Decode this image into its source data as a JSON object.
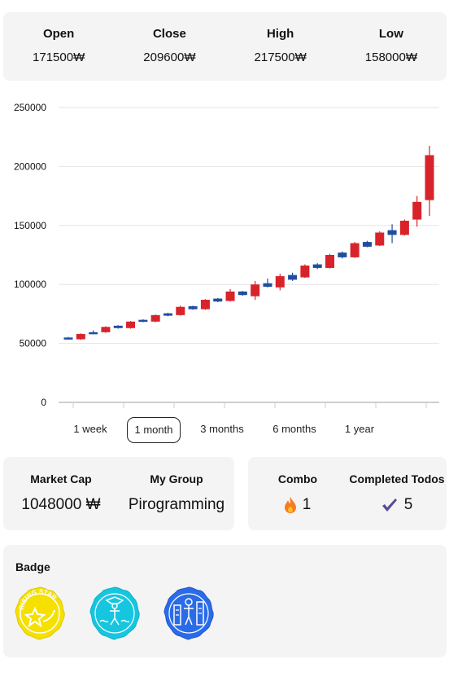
{
  "summary": {
    "open": {
      "label": "Open",
      "value": "171500₩"
    },
    "close": {
      "label": "Close",
      "value": "209600₩"
    },
    "high": {
      "label": "High",
      "value": "217500₩"
    },
    "low": {
      "label": "Low",
      "value": "158000₩"
    }
  },
  "chart_data": {
    "type": "candlestick",
    "ylim": [
      0,
      250000
    ],
    "yticks": [
      "250000",
      "200000",
      "150000",
      "100000",
      "50000",
      "0"
    ],
    "colors": {
      "up": "#d8232a",
      "down": "#1e4ea0",
      "grid": "#e6e6e6"
    },
    "candles": [
      {
        "open": 55000,
        "close": 54000,
        "high": 55500,
        "low": 53500
      },
      {
        "open": 53500,
        "close": 58000,
        "high": 58500,
        "low": 53000
      },
      {
        "open": 59500,
        "close": 58500,
        "high": 61000,
        "low": 58000
      },
      {
        "open": 59500,
        "close": 64000,
        "high": 64500,
        "low": 59000
      },
      {
        "open": 65000,
        "close": 63000,
        "high": 65500,
        "low": 62500
      },
      {
        "open": 63000,
        "close": 68500,
        "high": 69000,
        "low": 62500
      },
      {
        "open": 70000,
        "close": 68500,
        "high": 70500,
        "low": 68000
      },
      {
        "open": 68500,
        "close": 74000,
        "high": 74500,
        "low": 68000
      },
      {
        "open": 75500,
        "close": 73500,
        "high": 76000,
        "low": 73000
      },
      {
        "open": 74000,
        "close": 81000,
        "high": 82000,
        "low": 73500
      },
      {
        "open": 81500,
        "close": 79000,
        "high": 82000,
        "low": 78500
      },
      {
        "open": 79000,
        "close": 87000,
        "high": 87500,
        "low": 78500
      },
      {
        "open": 88000,
        "close": 85500,
        "high": 88500,
        "low": 85000
      },
      {
        "open": 86000,
        "close": 94000,
        "high": 96000,
        "low": 85500
      },
      {
        "open": 94000,
        "close": 91000,
        "high": 94500,
        "low": 90500
      },
      {
        "open": 90000,
        "close": 100000,
        "high": 103000,
        "low": 87000
      },
      {
        "open": 101000,
        "close": 98000,
        "high": 105000,
        "low": 97500
      },
      {
        "open": 97500,
        "close": 107000,
        "high": 109000,
        "low": 95000
      },
      {
        "open": 108000,
        "close": 104000,
        "high": 110000,
        "low": 103000
      },
      {
        "open": 106000,
        "close": 116000,
        "high": 117000,
        "low": 105500
      },
      {
        "open": 117000,
        "close": 114000,
        "high": 118000,
        "low": 113000
      },
      {
        "open": 114000,
        "close": 125000,
        "high": 126000,
        "low": 113500
      },
      {
        "open": 127000,
        "close": 123000,
        "high": 128000,
        "low": 122000
      },
      {
        "open": 123000,
        "close": 135000,
        "high": 136000,
        "low": 122500
      },
      {
        "open": 136000,
        "close": 132000,
        "high": 137000,
        "low": 131500
      },
      {
        "open": 133000,
        "close": 144000,
        "high": 145000,
        "low": 132500
      },
      {
        "open": 146000,
        "close": 142000,
        "high": 151000,
        "low": 135000
      },
      {
        "open": 142000,
        "close": 154000,
        "high": 155000,
        "low": 141500
      },
      {
        "open": 155000,
        "close": 170000,
        "high": 175000,
        "low": 149000
      },
      {
        "open": 171500,
        "close": 209600,
        "high": 217500,
        "low": 158000
      }
    ]
  },
  "ranges": {
    "week": "1 week",
    "month": "1 month",
    "three_months": "3 months",
    "six_months": "6 months",
    "year": "1 year",
    "active": "1 month"
  },
  "stats": {
    "market_cap": {
      "label": "Market Cap",
      "value": "1048000 ₩"
    },
    "group": {
      "label": "My Group",
      "value": "Pirogramming"
    },
    "combo": {
      "label": "Combo",
      "value": "1",
      "icon": "fire-icon"
    },
    "todos": {
      "label": "Completed Todos",
      "value": "5",
      "icon": "check-icon"
    }
  },
  "badges": {
    "label": "Badge",
    "items": [
      {
        "name": "rising-star-badge",
        "color": "#f5e000",
        "text": "RISING STAR"
      },
      {
        "name": "climber-badge",
        "color": "#16c6e0"
      },
      {
        "name": "city-badge",
        "color": "#2a6be8"
      }
    ]
  }
}
